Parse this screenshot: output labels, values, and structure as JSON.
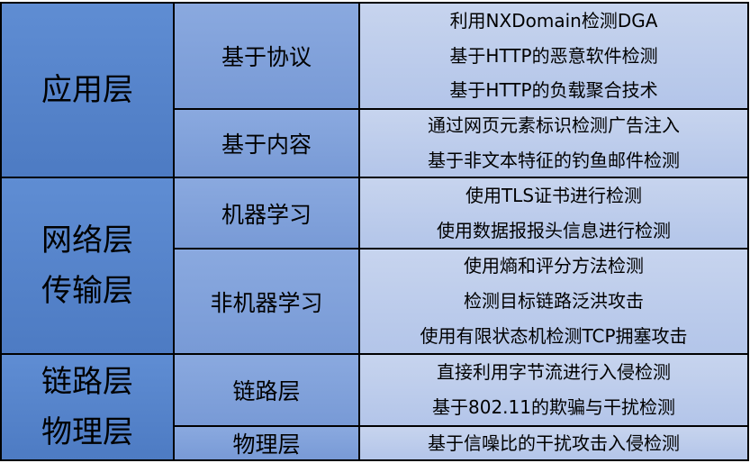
{
  "colors": {
    "col1_top": "#5f8dd3",
    "col1_bottom": "#4d7bc3",
    "col2_top": "#8aa9df",
    "col2_bottom": "#789ad6",
    "col3_top": "#c7d4ee",
    "col3_bottom": "#b3c5e9",
    "border": "#000000",
    "text": "#000000"
  },
  "groups": [
    {
      "layer": [
        "应用层"
      ],
      "subs": [
        {
          "name": "基于协议",
          "items": [
            "利用NXDomain检测DGA",
            "基于HTTP的恶意软件检测",
            "基于HTTP的负载聚合技术"
          ]
        },
        {
          "name": "基于内容",
          "items": [
            "通过网页元素标识检测广告注入",
            "基于非文本特征的钓鱼邮件检测"
          ]
        }
      ]
    },
    {
      "layer": [
        "网络层",
        "传输层"
      ],
      "subs": [
        {
          "name": "机器学习",
          "items": [
            "使用TLS证书进行检测",
            "使用数据报报头信息进行检测"
          ]
        },
        {
          "name": "非机器学习",
          "items": [
            "使用熵和评分方法检测",
            "检测目标链路泛洪攻击",
            "使用有限状态机检测TCP拥塞攻击"
          ]
        }
      ]
    },
    {
      "layer": [
        "链路层",
        "物理层"
      ],
      "subs": [
        {
          "name": "链路层",
          "items": [
            "直接利用字节流进行入侵检测",
            "基于802.11的欺骗与干扰检测"
          ]
        },
        {
          "name": "物理层",
          "items": [
            "基于信噪比的干扰攻击入侵检测"
          ]
        }
      ]
    }
  ]
}
